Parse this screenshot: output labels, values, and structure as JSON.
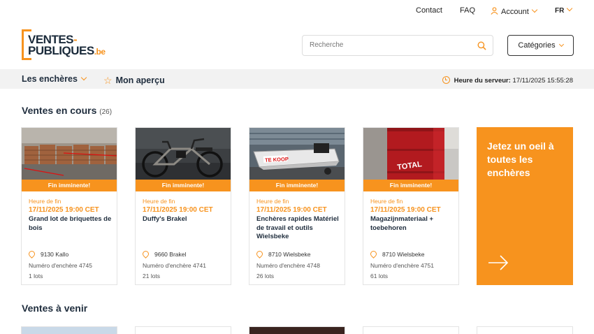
{
  "topbar": {
    "contact": "Contact",
    "faq": "FAQ",
    "account": "Account",
    "lang": "FR"
  },
  "logo": {
    "line1": "VENTES",
    "dash": "-",
    "line2": "PUBLIQUES",
    "tld": ".be"
  },
  "search": {
    "placeholder": "Recherche"
  },
  "categories_label": "Catégories",
  "nav": {
    "auctions": "Les enchères",
    "overview": "Mon aperçu",
    "server_label": "Heure du serveur:",
    "server_time": "17/11/2025 15:55:28"
  },
  "current": {
    "title": "Ventes en cours",
    "count": "(26)",
    "cards": [
      {
        "ribbon": "Fin imminente!",
        "end_label": "Heure de fin",
        "end_date": "17/11/2025 19:00 CET",
        "title": "Grand lot de briquettes de bois",
        "location": "9130 Kallo",
        "number": "Numéro d'enchère 4745",
        "lots": "1 lots"
      },
      {
        "ribbon": "Fin imminente!",
        "end_label": "Heure de fin",
        "end_date": "17/11/2025 19:00 CET",
        "title": "Duffy's Brakel",
        "location": "9660 Brakel",
        "number": "Numéro d'enchère 4741",
        "lots": "21 lots"
      },
      {
        "ribbon": "Fin imminente!",
        "end_label": "Heure de fin",
        "end_date": "17/11/2025 19:00 CET",
        "title": "Enchères rapides Matériel de travail et outils Wielsbeke",
        "location": "8710 Wielsbeke",
        "number": "Numéro d'enchère 4748",
        "lots": "26 lots",
        "img_text": "TE KOOP"
      },
      {
        "ribbon": "Fin imminente!",
        "end_label": "Heure de fin",
        "end_date": "17/11/2025 19:00 CET",
        "title": "Magazijnmateriaal + toebehoren",
        "location": "8710 Wielsbeke",
        "number": "Numéro d'enchère 4751",
        "lots": "61 lots",
        "img_text": "TOTAL"
      }
    ],
    "promo": "Jetez un oeil à toutes les enchères"
  },
  "upcoming": {
    "title": "Ventes à venir"
  },
  "colors": {
    "accent": "#f7931e",
    "navy": "#1f2d3d",
    "navbar_bg": "#f2f2f2"
  }
}
